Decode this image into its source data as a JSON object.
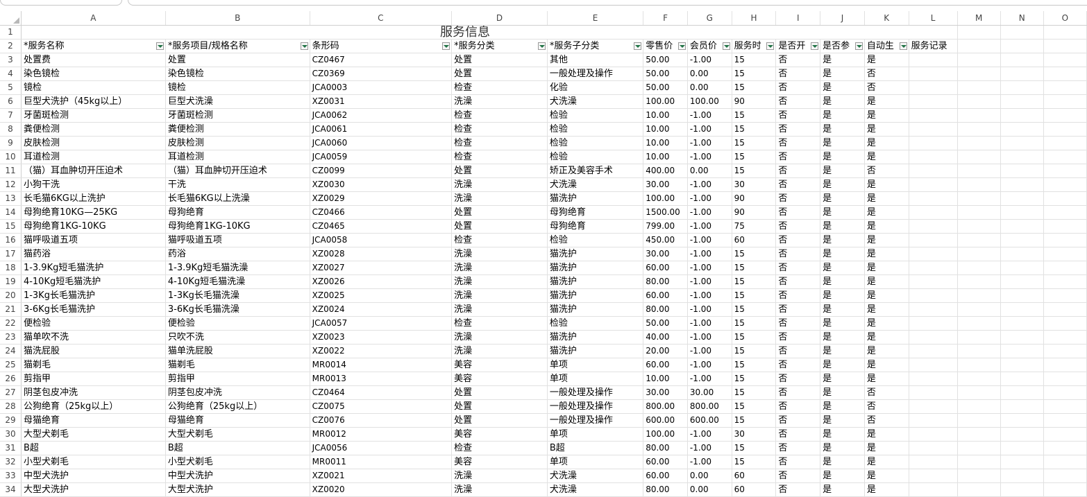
{
  "columns": [
    "A",
    "B",
    "C",
    "D",
    "E",
    "F",
    "G",
    "H",
    "I",
    "J",
    "K",
    "L",
    "M",
    "N",
    "O"
  ],
  "sheet_title": "服务信息",
  "headers": [
    "*服务名称",
    "*服务项目/规格名称",
    "条形码",
    "*服务分类",
    "*服务子分类",
    "零售价",
    "会员价",
    "服务时",
    "是否开",
    "是否参",
    "自动生",
    "服务记录"
  ],
  "rows": [
    [
      "处置费",
      "处置",
      "CZ0467",
      "处置",
      "其他",
      "50.00",
      "-1.00",
      "15",
      "否",
      "是",
      "是"
    ],
    [
      "染色镜检",
      "染色镜检",
      "CZ0369",
      "处置",
      "一般处理及操作",
      "50.00",
      "0.00",
      "15",
      "否",
      "是",
      "否"
    ],
    [
      "镜检",
      "镜检",
      "JCA0003",
      "检查",
      "化验",
      "50.00",
      "0.00",
      "15",
      "否",
      "是",
      "否"
    ],
    [
      "巨型犬洗护（45kg以上）",
      "巨型犬洗澡",
      "XZ0031",
      "洗澡",
      "犬洗澡",
      "100.00",
      "100.00",
      "90",
      "否",
      "是",
      "是"
    ],
    [
      "牙菌斑检测",
      "牙菌斑检测",
      "JCA0062",
      "检查",
      "检验",
      "10.00",
      "-1.00",
      "15",
      "否",
      "是",
      "是"
    ],
    [
      "粪便检测",
      "粪便检测",
      "JCA0061",
      "检查",
      "检验",
      "10.00",
      "-1.00",
      "15",
      "否",
      "是",
      "是"
    ],
    [
      "皮肤检测",
      "皮肤检测",
      "JCA0060",
      "检查",
      "检验",
      "10.00",
      "-1.00",
      "15",
      "否",
      "是",
      "是"
    ],
    [
      "耳道检测",
      "耳道检测",
      "JCA0059",
      "检查",
      "检验",
      "10.00",
      "-1.00",
      "15",
      "否",
      "是",
      "是"
    ],
    [
      "（猫）耳血肿切开压迫术",
      "（猫）耳血肿切开压迫术",
      "CZ0099",
      "处置",
      "矫正及美容手术",
      "400.00",
      "0.00",
      "15",
      "否",
      "是",
      "否"
    ],
    [
      "小狗干洗",
      "干洗",
      "XZ0030",
      "洗澡",
      "犬洗澡",
      "30.00",
      "-1.00",
      "30",
      "否",
      "是",
      "是"
    ],
    [
      "长毛猫6KG以上洗护",
      "长毛猫6KG以上洗澡",
      "XZ0029",
      "洗澡",
      "猫洗护",
      "100.00",
      "-1.00",
      "90",
      "否",
      "是",
      "是"
    ],
    [
      "母狗绝育10KG—25KG",
      "母狗绝育",
      "CZ0466",
      "处置",
      "母狗绝育",
      "1500.00",
      "-1.00",
      "90",
      "否",
      "是",
      "是"
    ],
    [
      "母狗绝育1KG-10KG",
      "母狗绝育1KG-10KG",
      "CZ0465",
      "处置",
      "母狗绝育",
      "799.00",
      "-1.00",
      "75",
      "否",
      "是",
      "是"
    ],
    [
      "猫呼吸道五项",
      "猫呼吸道五项",
      "JCA0058",
      "检查",
      "检验",
      "450.00",
      "-1.00",
      "60",
      "否",
      "是",
      "是"
    ],
    [
      "猫药浴",
      "药浴",
      "XZ0028",
      "洗澡",
      "猫洗护",
      "30.00",
      "-1.00",
      "15",
      "否",
      "是",
      "是"
    ],
    [
      "1-3.9Kg短毛猫洗护",
      "1-3.9Kg短毛猫洗澡",
      "XZ0027",
      "洗澡",
      "猫洗护",
      "60.00",
      "-1.00",
      "15",
      "否",
      "是",
      "是"
    ],
    [
      "4-10Kg短毛猫洗护",
      "4-10Kg短毛猫洗澡",
      "XZ0026",
      "洗澡",
      "猫洗护",
      "80.00",
      "-1.00",
      "15",
      "否",
      "是",
      "是"
    ],
    [
      "1-3Kg长毛猫洗护",
      "1-3Kg长毛猫洗澡",
      "XZ0025",
      "洗澡",
      "猫洗护",
      "60.00",
      "-1.00",
      "15",
      "否",
      "是",
      "是"
    ],
    [
      "3-6Kg长毛猫洗护",
      "3-6Kg长毛猫洗澡",
      "XZ0024",
      "洗澡",
      "猫洗护",
      "80.00",
      "-1.00",
      "15",
      "否",
      "是",
      "是"
    ],
    [
      "便检验",
      "便检验",
      "JCA0057",
      "检查",
      "检验",
      "50.00",
      "-1.00",
      "15",
      "否",
      "是",
      "是"
    ],
    [
      "猫单吹不洗",
      "只吹不洗",
      "XZ0023",
      "洗澡",
      "猫洗护",
      "40.00",
      "-1.00",
      "15",
      "否",
      "是",
      "是"
    ],
    [
      "猫洗屁股",
      "猫单洗屁股",
      "XZ0022",
      "洗澡",
      "猫洗护",
      "20.00",
      "-1.00",
      "15",
      "否",
      "是",
      "是"
    ],
    [
      "猫剃毛",
      "猫剃毛",
      "MR0014",
      "美容",
      "单项",
      "60.00",
      "-1.00",
      "15",
      "否",
      "是",
      "是"
    ],
    [
      "剪指甲",
      "剪指甲",
      "MR0013",
      "美容",
      "单项",
      "10.00",
      "-1.00",
      "15",
      "否",
      "是",
      "是"
    ],
    [
      "阴茎包皮冲洗",
      "阴茎包皮冲洗",
      "CZ0464",
      "处置",
      "一般处理及操作",
      "30.00",
      "30.00",
      "15",
      "否",
      "是",
      "否"
    ],
    [
      "公狗绝育（25kg以上）",
      "公狗绝育（25kg以上）",
      "CZ0075",
      "处置",
      "一般处理及操作",
      "800.00",
      "800.00",
      "15",
      "否",
      "是",
      "否"
    ],
    [
      "母猫绝育",
      "母猫绝育",
      "CZ0076",
      "处置",
      "一般处理及操作",
      "600.00",
      "600.00",
      "15",
      "否",
      "是",
      "否"
    ],
    [
      "大型犬剃毛",
      "大型犬剃毛",
      "MR0012",
      "美容",
      "单项",
      "100.00",
      "-1.00",
      "30",
      "否",
      "是",
      "是"
    ],
    [
      "B超",
      "B超",
      "JCA0056",
      "检查",
      "B超",
      "80.00",
      "-1.00",
      "15",
      "否",
      "是",
      "是"
    ],
    [
      "小型犬剃毛",
      "小型犬剃毛",
      "MR0011",
      "美容",
      "单项",
      "60.00",
      "-1.00",
      "15",
      "否",
      "是",
      "是"
    ],
    [
      "中型犬洗护",
      "中型犬洗护",
      "XZ0021",
      "洗澡",
      "犬洗澡",
      "60.00",
      "0.00",
      "60",
      "否",
      "是",
      "是"
    ],
    [
      "大型犬洗护",
      "大型犬洗护",
      "XZ0020",
      "洗澡",
      "犬洗澡",
      "80.00",
      "0.00",
      "60",
      "否",
      "是",
      "是"
    ]
  ]
}
